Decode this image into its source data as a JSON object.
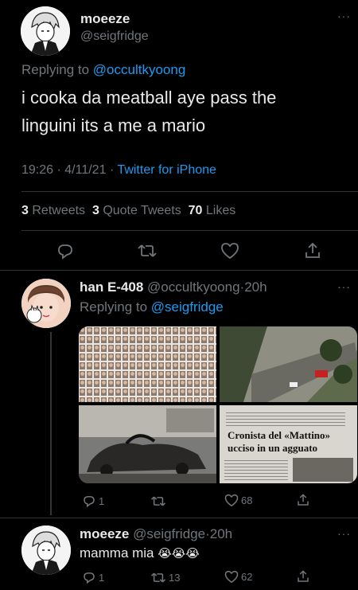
{
  "main_tweet": {
    "display_name": "moeeze",
    "handle": "@seigfridge",
    "replying_prefix": "Replying to",
    "replying_to": "@occultkyoong",
    "text_line1": "i cooka da meatball aye pass the",
    "text_line2": "linguini its a me a mario",
    "time": "19:26",
    "sep1": "·",
    "date": "4/11/21",
    "sep2": "·",
    "client": "Twitter for iPhone",
    "stats": {
      "retweets_count": "3",
      "retweets_label": "Retweets",
      "quotes_count": "3",
      "quotes_label": "Quote Tweets",
      "likes_count": "70",
      "likes_label": "Likes"
    }
  },
  "reply_tweet": {
    "display_name": "han E-408",
    "handle": "@occultkyoong",
    "sep": "·",
    "age": "20h",
    "replying_prefix": "Replying to",
    "replying_to": "@seigfridge",
    "newspaper_headline1": "Cronista del «Mattino»",
    "newspaper_headline2": "ucciso in un agguato",
    "reply_count": "1",
    "like_count": "68"
  },
  "bottom_tweet": {
    "display_name": "moeeze",
    "handle": "@seigfridge",
    "sep": "·",
    "age": "20h",
    "text": "mamma mia",
    "emoji": "😭😭😭",
    "reply_count": "1",
    "retweet_count": "13",
    "like_count": "62"
  },
  "colors": {
    "accent": "#1d9bf0",
    "muted": "#71767b",
    "text": "#e7e9ea",
    "background": "#000000"
  }
}
